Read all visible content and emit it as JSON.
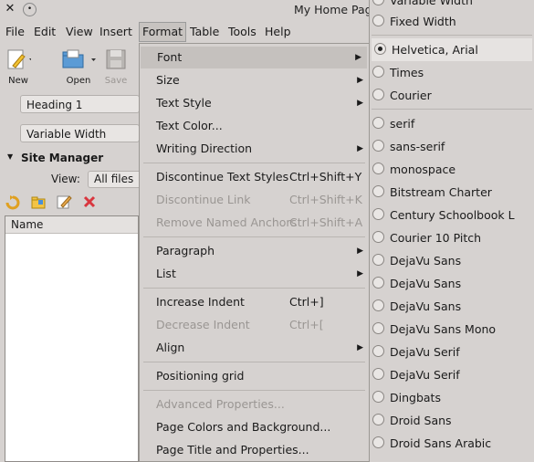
{
  "window": {
    "title": "My Home Page"
  },
  "menubar": [
    "File",
    "Edit",
    "View",
    "Insert",
    "Format",
    "Table",
    "Tools",
    "Help"
  ],
  "toolbar": {
    "new_label": "New",
    "open_label": "Open",
    "save_label": "Save"
  },
  "format_bar": {
    "paragraph_style": "Heading 1",
    "font_width": "Variable Width"
  },
  "site_manager": {
    "title": "Site Manager",
    "view_label": "View:",
    "view_value": "All files",
    "column_name": "Name"
  },
  "format_menu": {
    "font": "Font",
    "size": "Size",
    "text_style": "Text Style",
    "text_color": "Text Color...",
    "writing_direction": "Writing Direction",
    "discontinue_text_styles": "Discontinue Text Styles",
    "discontinue_text_styles_sc": "Ctrl+Shift+Y",
    "discontinue_link": "Discontinue Link",
    "discontinue_link_sc": "Ctrl+Shift+K",
    "remove_named_anchors": "Remove Named Anchors",
    "remove_named_anchors_sc": "Ctrl+Shift+A",
    "paragraph": "Paragraph",
    "list": "List",
    "increase_indent": "Increase Indent",
    "increase_indent_sc": "Ctrl+]",
    "decrease_indent": "Decrease Indent",
    "decrease_indent_sc": "Ctrl+[",
    "align": "Align",
    "positioning_grid": "Positioning grid",
    "advanced_properties": "Advanced Properties...",
    "page_colors": "Page Colors and Background...",
    "page_title": "Page Title and Properties..."
  },
  "font_submenu": {
    "variable_width": "Variable Width",
    "fixed_width": "Fixed Width",
    "helvetica": "Helvetica, Arial",
    "times": "Times",
    "courier": "Courier",
    "fonts": [
      "serif",
      "sans-serif",
      "monospace",
      "Bitstream Charter",
      "Century Schoolbook L",
      "Courier 10 Pitch",
      "DejaVu Sans",
      "DejaVu Sans",
      "DejaVu Sans",
      "DejaVu Sans Mono",
      "DejaVu Serif",
      "DejaVu Serif",
      "Dingbats",
      "Droid Sans",
      "Droid Sans Arabic"
    ]
  }
}
